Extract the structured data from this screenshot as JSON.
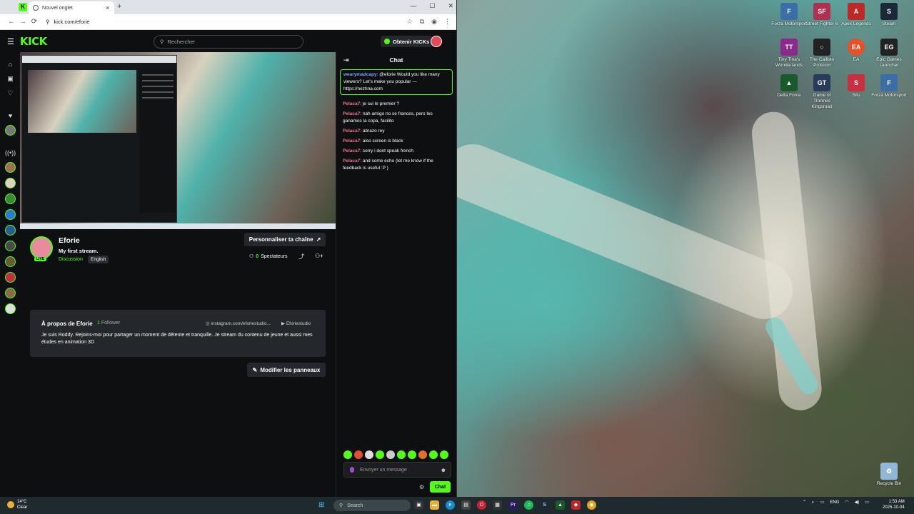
{
  "browser": {
    "tab_title": "Nouvel onglet",
    "url": "kick.com/eforie"
  },
  "kick": {
    "logo": "KICK",
    "search_placeholder": "Rechercher",
    "get_kicks_label": "Obtenir KICKs",
    "channel": {
      "name": "Eforie",
      "stream_title": "My first stream.",
      "category": "Discussion",
      "language": "English",
      "live_badge": "LIVE",
      "personalize_label": "Personnaliser ta chaîne",
      "viewers_count": "0",
      "viewers_label": "Spectateurs"
    },
    "about": {
      "title": "À propos de Eforie",
      "followers_count": "1",
      "followers_label": "Follower",
      "instagram": "instagram.com/eforiestudio...",
      "youtube": "Eforiestudio",
      "bio": "Je suis Roddy. Rejoins-moi pour partager un moment de détente et tranquille. Je stream du contenu de jeune et aussi mes études en animation 3D"
    },
    "edit_panels_label": "Modifier les panneaux",
    "chat": {
      "title": "Chat",
      "messages": [
        {
          "user": "wearymadcapy",
          "text": ": @eforie Would you like many viewers? Let's make you popular — https://nezhna.com"
        },
        {
          "user": "Pelaca7",
          "text": ": je sui le premier ?"
        },
        {
          "user": "Pelaca7",
          "text": ": nah amigo no se frances, pero les ganamos la copa, facilito"
        },
        {
          "user": "Pelaca7",
          "text": ": abrazo rey"
        },
        {
          "user": "Pelaca7",
          "text": ": also screen is black"
        },
        {
          "user": "Pelaca7",
          "text": ": sorry i dont speak french"
        },
        {
          "user": "Pelaca7",
          "text": ": and some echo (let me know if the feedback is useful :P )"
        }
      ],
      "input_placeholder": "Envoyer un message",
      "send_label": "Chat"
    }
  },
  "desktop_icons": [
    {
      "label": "Forza Motorsport",
      "color": "#3a6ea5"
    },
    {
      "label": "Street Fighter 6",
      "color": "#b03050"
    },
    {
      "label": "Apex Legends",
      "color": "#c02828"
    },
    {
      "label": "Steam",
      "color": "#1b2838"
    },
    {
      "label": "Tiny Tina's Wonderlands",
      "color": "#8a2a8a"
    },
    {
      "label": "The Callisto Protocol",
      "color": "#222222"
    },
    {
      "label": "EA",
      "color": "#e8502a"
    },
    {
      "label": "Epic Games Launcher",
      "color": "#222222"
    },
    {
      "label": "Delta Force",
      "color": "#1a5a2a"
    },
    {
      "label": "Game of Thrones Kingsroad",
      "color": "#2a3a5a"
    },
    {
      "label": "Sifu",
      "color": "#c83040"
    },
    {
      "label": "Forza Motorsport",
      "color": "#3a6ea5"
    }
  ],
  "recycle_bin": "Recycle Bin",
  "taskbar": {
    "temp": "14°C",
    "weather": "Clear",
    "search": "Search",
    "lang": "ENG",
    "time": "1:53 AM",
    "date": "2025-10-04"
  }
}
